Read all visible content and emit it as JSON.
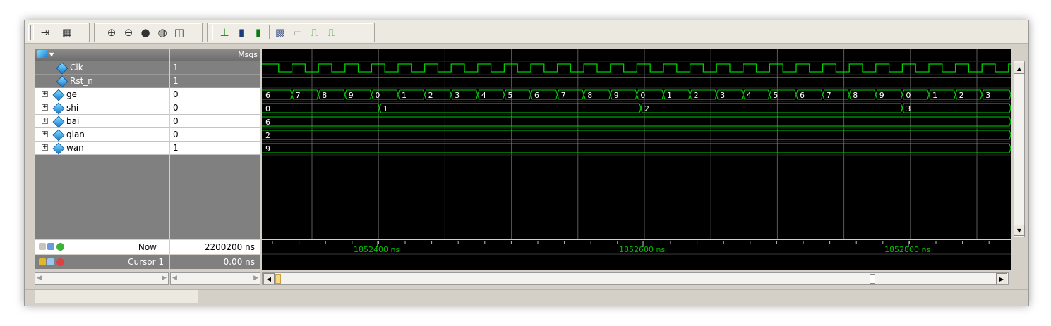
{
  "toolbar": {
    "groups": [
      [
        "insert-cursor-icon",
        "tree-icon"
      ],
      [
        "zoom-in-icon",
        "zoom-out-icon",
        "zoom-full-icon",
        "zoom-cursor-icon",
        "zoom-region-icon"
      ],
      [
        "signal-edge-icon",
        "bar-icon",
        "green-bar-icon",
        "dotted-grid-icon",
        "step-wave-icon",
        "pulse-icon",
        "pulse2-icon"
      ]
    ]
  },
  "names_header": "",
  "values_header": "Msgs",
  "signals": [
    {
      "name": "Clk",
      "value": "1",
      "expandable": false,
      "style": "gray"
    },
    {
      "name": "Rst_n",
      "value": "1",
      "expandable": false,
      "style": "gray"
    },
    {
      "name": "ge",
      "value": "0",
      "expandable": true,
      "style": "white"
    },
    {
      "name": "shi",
      "value": "0",
      "expandable": true,
      "style": "white"
    },
    {
      "name": "bai",
      "value": "0",
      "expandable": true,
      "style": "white"
    },
    {
      "name": "qian",
      "value": "0",
      "expandable": true,
      "style": "white"
    },
    {
      "name": "wan",
      "value": "1",
      "expandable": true,
      "style": "white"
    }
  ],
  "waves": {
    "ge_labels": [
      "6",
      "7",
      "8",
      "9",
      "0",
      "1",
      "2",
      "3",
      "4",
      "5",
      "6",
      "7",
      "8",
      "9",
      "0",
      "1",
      "2",
      "3",
      "4",
      "5",
      "6",
      "7",
      "8",
      "9",
      "0",
      "1",
      "2",
      "3"
    ],
    "shi_labels": [
      {
        "t": 0,
        "label": "0"
      },
      {
        "t": 4.3,
        "label": "1"
      },
      {
        "t": 14.15,
        "label": "2"
      },
      {
        "t": 24.0,
        "label": "3"
      }
    ],
    "bai_label": "6",
    "qian_label": "2",
    "wan_label": "9"
  },
  "status": {
    "now_label": "Now",
    "now_value": "2200200 ns",
    "cursor_label": "Cursor 1",
    "cursor_value": "0.00 ns"
  },
  "timeline": {
    "ticks": [
      {
        "t": 1852400,
        "label": "1852400 ns"
      },
      {
        "t": 1852600,
        "label": "1852600 ns"
      },
      {
        "t": 1852800,
        "label": "1852800 ns"
      }
    ]
  },
  "colors": {
    "wave": "#00d000",
    "bg": "#000000",
    "grid": "#5a5a5a",
    "timeline_text": "#00c000"
  }
}
